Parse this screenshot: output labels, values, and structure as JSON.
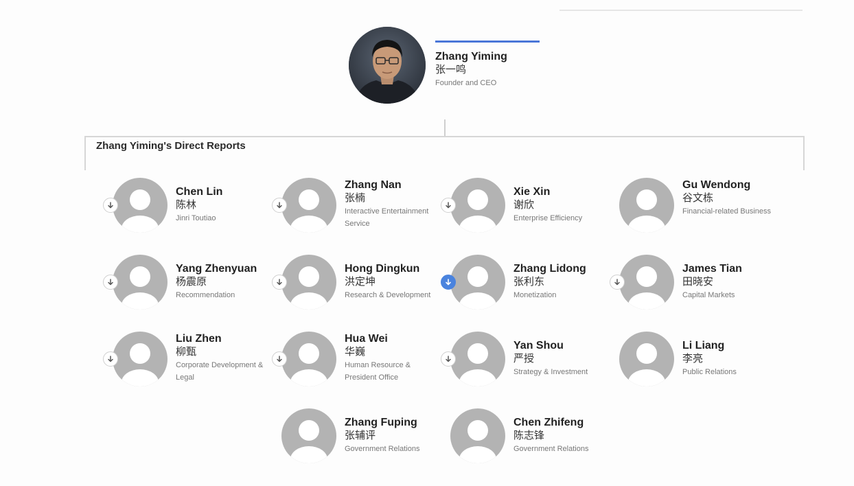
{
  "ceo": {
    "name_en": "Zhang Yiming",
    "name_zh": "张一鸣",
    "title": "Founder and CEO"
  },
  "direct_reports_heading": "Zhang Yiming's Direct Reports",
  "colors": {
    "accent": "#4a76d8",
    "expand_active": "#4a83de",
    "avatar_placeholder": "#b3b3b3",
    "connector": "#d6d6d6"
  },
  "reports": [
    {
      "name_en": "Chen Lin",
      "name_zh": "陈林",
      "title": "Jinri Toutiao",
      "expandable": true,
      "expanded": false
    },
    {
      "name_en": "Zhang Nan",
      "name_zh": "张楠",
      "title": "Interactive Entertainment Service",
      "expandable": true,
      "expanded": false
    },
    {
      "name_en": "Xie Xin",
      "name_zh": "谢欣",
      "title": "Enterprise Efficiency",
      "expandable": true,
      "expanded": false
    },
    {
      "name_en": "Gu Wendong",
      "name_zh": "谷文栋",
      "title": "Financial-related Business",
      "expandable": false,
      "expanded": false
    },
    {
      "name_en": "Yang Zhenyuan",
      "name_zh": "杨震原",
      "title": "Recommendation",
      "expandable": true,
      "expanded": false
    },
    {
      "name_en": "Hong Dingkun",
      "name_zh": "洪定坤",
      "title": "Research & Development",
      "expandable": true,
      "expanded": false
    },
    {
      "name_en": "Zhang Lidong",
      "name_zh": "张利东",
      "title": "Monetization",
      "expandable": true,
      "expanded": true
    },
    {
      "name_en": "James Tian",
      "name_zh": "田晓安",
      "title": "Capital Markets",
      "expandable": true,
      "expanded": false
    },
    {
      "name_en": "Liu Zhen",
      "name_zh": "柳甄",
      "title": "Corporate Development & Legal",
      "expandable": true,
      "expanded": false
    },
    {
      "name_en": "Hua Wei",
      "name_zh": "华巍",
      "title": "Human Resource & President Office",
      "expandable": true,
      "expanded": false
    },
    {
      "name_en": "Yan Shou",
      "name_zh": "严授",
      "title": "Strategy & Investment",
      "expandable": true,
      "expanded": false
    },
    {
      "name_en": "Li Liang",
      "name_zh": "李亮",
      "title": "Public Relations",
      "expandable": false,
      "expanded": false
    },
    {
      "name_en": "Zhang Fuping",
      "name_zh": "张辅评",
      "title": "Government Relations",
      "expandable": false,
      "expanded": false
    },
    {
      "name_en": "Chen Zhifeng",
      "name_zh": "陈志锋",
      "title": "Government Relations",
      "expandable": false,
      "expanded": false
    }
  ]
}
